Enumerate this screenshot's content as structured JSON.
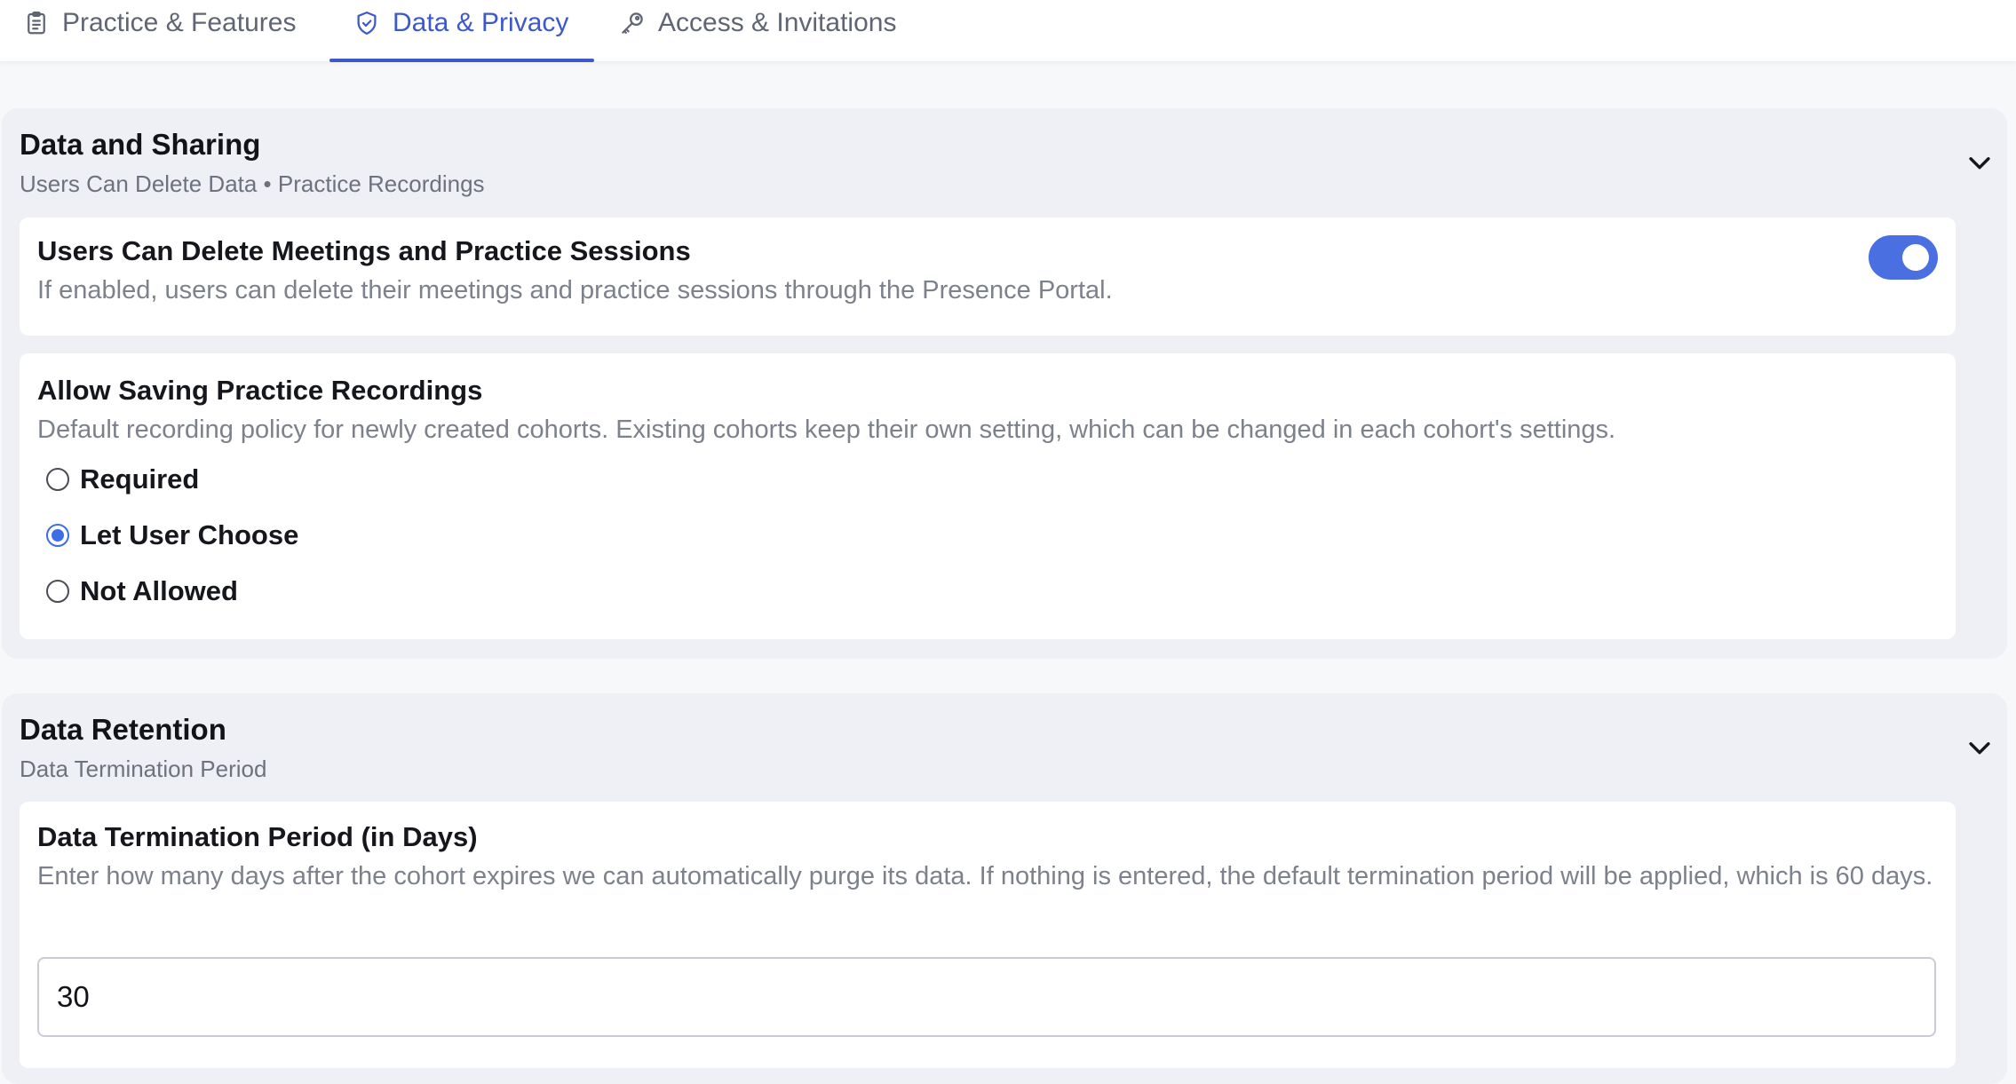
{
  "tabs": [
    {
      "label": "Practice & Features",
      "icon": "clipboard-icon",
      "active": false
    },
    {
      "label": "Data & Privacy",
      "icon": "shield-icon",
      "active": true
    },
    {
      "label": "Access & Invitations",
      "icon": "key-icon",
      "active": false
    }
  ],
  "colors": {
    "accent": "#3d58cc",
    "toggle_on": "#4a6fe0",
    "section_bg": "#eff0f5"
  },
  "data_sharing": {
    "title": "Data and Sharing",
    "subtitle": "Users Can Delete Data • Practice Recordings",
    "delete_setting": {
      "title": "Users Can Delete Meetings and Practice Sessions",
      "description": "If enabled, users can delete their meetings and practice sessions through the Presence Portal.",
      "enabled": true
    },
    "recording_setting": {
      "title": "Allow Saving Practice Recordings",
      "description": "Default recording policy for newly created cohorts. Existing cohorts keep their own setting, which can be changed in each cohort's settings.",
      "options": [
        "Required",
        "Let User Choose",
        "Not Allowed"
      ],
      "selected": "Let User Choose"
    }
  },
  "data_retention": {
    "title": "Data Retention",
    "subtitle": "Data Termination Period",
    "termination": {
      "title": "Data Termination Period (in Days)",
      "description": "Enter how many days after the cohort expires we can automatically purge its data. If nothing is entered, the default termination period will be applied, which is 60 days.",
      "value": "30"
    }
  }
}
